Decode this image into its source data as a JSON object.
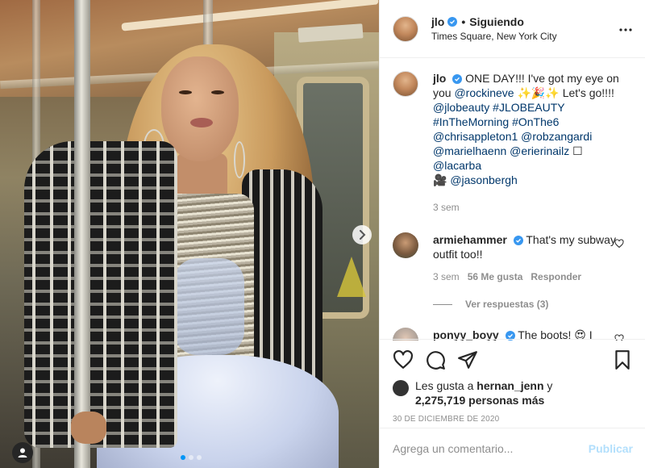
{
  "post": {
    "author": {
      "username": "jlo",
      "follow_separator": "•",
      "follow_state": "Siguiendo",
      "location": "Times Square, New York City",
      "verified": true
    },
    "more_icon": "more-horizontal-icon",
    "carousel": {
      "slide_count": 3,
      "active_slide": 1
    },
    "caption": {
      "username": "jlo",
      "text_1": " ONE DAY!!! I've got my eye on you ",
      "mention_1": "@rockineve",
      "emoji_1": " ✨🎉✨ ",
      "text_2": "Let's go!!!!",
      "tag_1": "@jlobeauty",
      "tag_2": "#JLOBEAUTY",
      "tag_3": "#InTheMorning",
      "tag_4": "#OnThe6",
      "tag_5": "@chrisappleton1",
      "tag_6": "@robzangardi",
      "tag_7": "@marielhaenn",
      "tag_8": "@erierinailz",
      "box_glyph": " ☐ ",
      "tag_9": "@lacarba",
      "camera_glyph": "🎥",
      "tag_10": "@jasonbergh",
      "time": "3 sem"
    },
    "comments": [
      {
        "username": "armiehammer",
        "text": " That's my subway outfit too!!",
        "time": "3 sem",
        "likes": "56 Me gusta",
        "reply": "Responder",
        "view_replies": "Ver respuestas (3)"
      },
      {
        "username": "ponyy_boyy",
        "text": " The boots! 😍 I looove! 🙌🏼"
      }
    ],
    "likes": {
      "prefix": "Les gusta a ",
      "first_liker": "hernan_jenn",
      "suffix": " y",
      "count": "2,275,719 personas más"
    },
    "date": "30 DE DICIEMBRE DE 2020",
    "comment_box": {
      "placeholder": "Agrega un comentario...",
      "publish": "Publicar"
    }
  },
  "colors": {
    "link": "#00376b",
    "verified": "#3897f0",
    "publish_disabled": "#b2dffc",
    "muted": "#8e8e8e"
  }
}
